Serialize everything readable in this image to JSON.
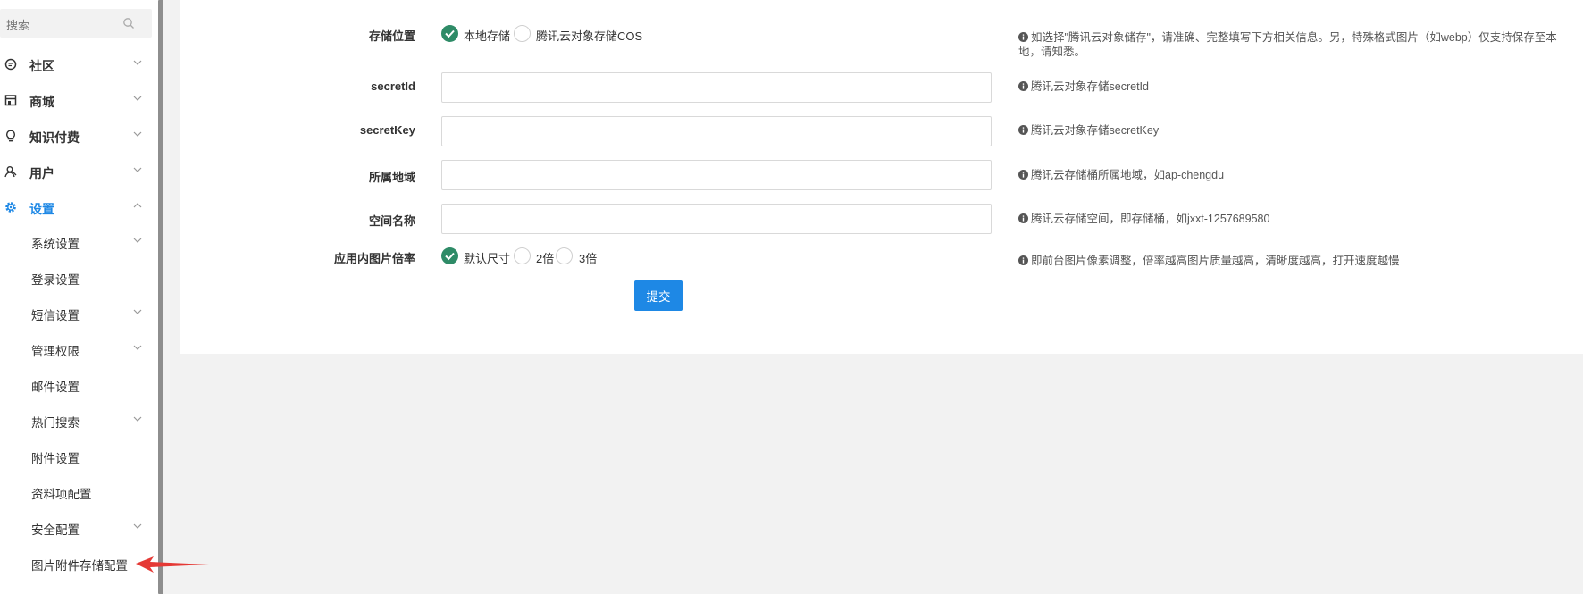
{
  "sidebar": {
    "search": {
      "placeholder": "搜索",
      "icon": "search-icon"
    },
    "nav": [
      {
        "label": "社区",
        "icon": "chat-icon",
        "expanded": false
      },
      {
        "label": "商城",
        "icon": "store-icon",
        "expanded": false
      },
      {
        "label": "知识付费",
        "icon": "lightbulb-icon",
        "expanded": false
      },
      {
        "label": "用户",
        "icon": "user-icon",
        "expanded": false
      },
      {
        "label": "设置",
        "icon": "gear-icon",
        "expanded": true,
        "active": true
      }
    ],
    "settings_items": [
      {
        "label": "系统设置",
        "has_children": true
      },
      {
        "label": "登录设置",
        "has_children": false
      },
      {
        "label": "短信设置",
        "has_children": true
      },
      {
        "label": "管理权限",
        "has_children": true
      },
      {
        "label": "邮件设置",
        "has_children": false
      },
      {
        "label": "热门搜索",
        "has_children": true
      },
      {
        "label": "附件设置",
        "has_children": false
      },
      {
        "label": "资料项配置",
        "has_children": false
      },
      {
        "label": "安全配置",
        "has_children": true
      },
      {
        "label": "图片附件存储配置",
        "has_children": false,
        "current": true
      }
    ]
  },
  "form": {
    "storage": {
      "label": "存储位置",
      "options": [
        "本地存储",
        "腾讯云对象存储COS"
      ],
      "selected": "本地存储",
      "hint": "如选择\"腾讯云对象储存\"，请准确、完整填写下方相关信息。另，特殊格式图片（如webp）仅支持保存至本地，请知悉。"
    },
    "secret_id": {
      "label": "secretId",
      "value": "",
      "hint": "腾讯云对象存储secretId"
    },
    "secret_key": {
      "label": "secretKey",
      "value": "",
      "hint": "腾讯云对象存储secretKey"
    },
    "region": {
      "label": "所属地域",
      "value": "",
      "hint": "腾讯云存储桶所属地域，如ap-chengdu"
    },
    "bucket": {
      "label": "空间名称",
      "value": "",
      "hint": "腾讯云存储空间，即存储桶，如jxxt-1257689580"
    },
    "scale": {
      "label": "应用内图片倍率",
      "options": [
        "默认尺寸",
        "2倍",
        "3倍"
      ],
      "selected": "默认尺寸",
      "hint": "即前台图片像素调整，倍率越高图片质量越高，清晰度越高，打开速度越慢"
    },
    "submit_label": "提交"
  },
  "colors": {
    "accent": "#1e88e5",
    "radio_checked": "#2e8b67",
    "annotation_arrow": "#e53935"
  }
}
